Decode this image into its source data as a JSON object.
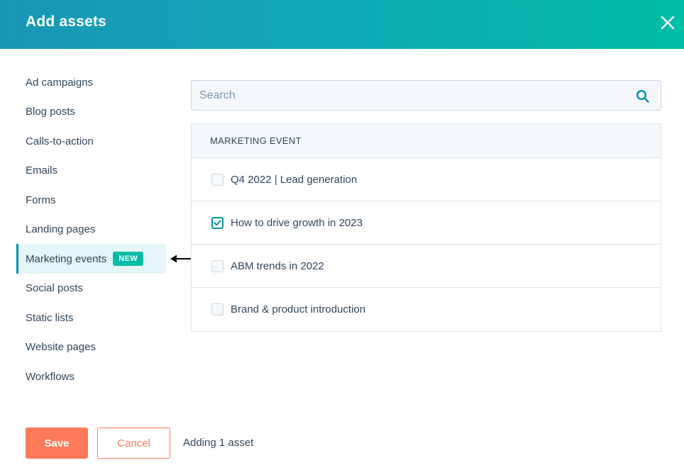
{
  "header": {
    "title": "Add assets",
    "close_icon": "close-icon",
    "gradient_start": "#1996b5",
    "gradient_end": "#00bda5"
  },
  "sidebar": {
    "items": [
      {
        "label": "Ad campaigns"
      },
      {
        "label": "Blog posts"
      },
      {
        "label": "Calls-to-action"
      },
      {
        "label": "Emails"
      },
      {
        "label": "Forms"
      },
      {
        "label": "Landing pages"
      },
      {
        "label": "Marketing events",
        "badge": "NEW",
        "active": true
      },
      {
        "label": "Social posts"
      },
      {
        "label": "Static lists"
      },
      {
        "label": "Website pages"
      },
      {
        "label": "Workflows"
      }
    ]
  },
  "search": {
    "placeholder": "Search",
    "value": "",
    "icon": "search-icon"
  },
  "table": {
    "header": "MARKETING EVENT",
    "rows": [
      {
        "label": "Q4 2022 | Lead generation",
        "checked": false
      },
      {
        "label": "How to drive growth in 2023",
        "checked": true
      },
      {
        "label": "ABM trends in 2022",
        "checked": false
      },
      {
        "label": "Brand & product introduction",
        "checked": false
      }
    ]
  },
  "footer": {
    "save_label": "Save",
    "cancel_label": "Cancel",
    "status": "Adding 1 asset"
  },
  "colors": {
    "accent": "#0091ae",
    "primary_button": "#ff7a59",
    "badge": "#00bda5",
    "text": "#33475b"
  }
}
